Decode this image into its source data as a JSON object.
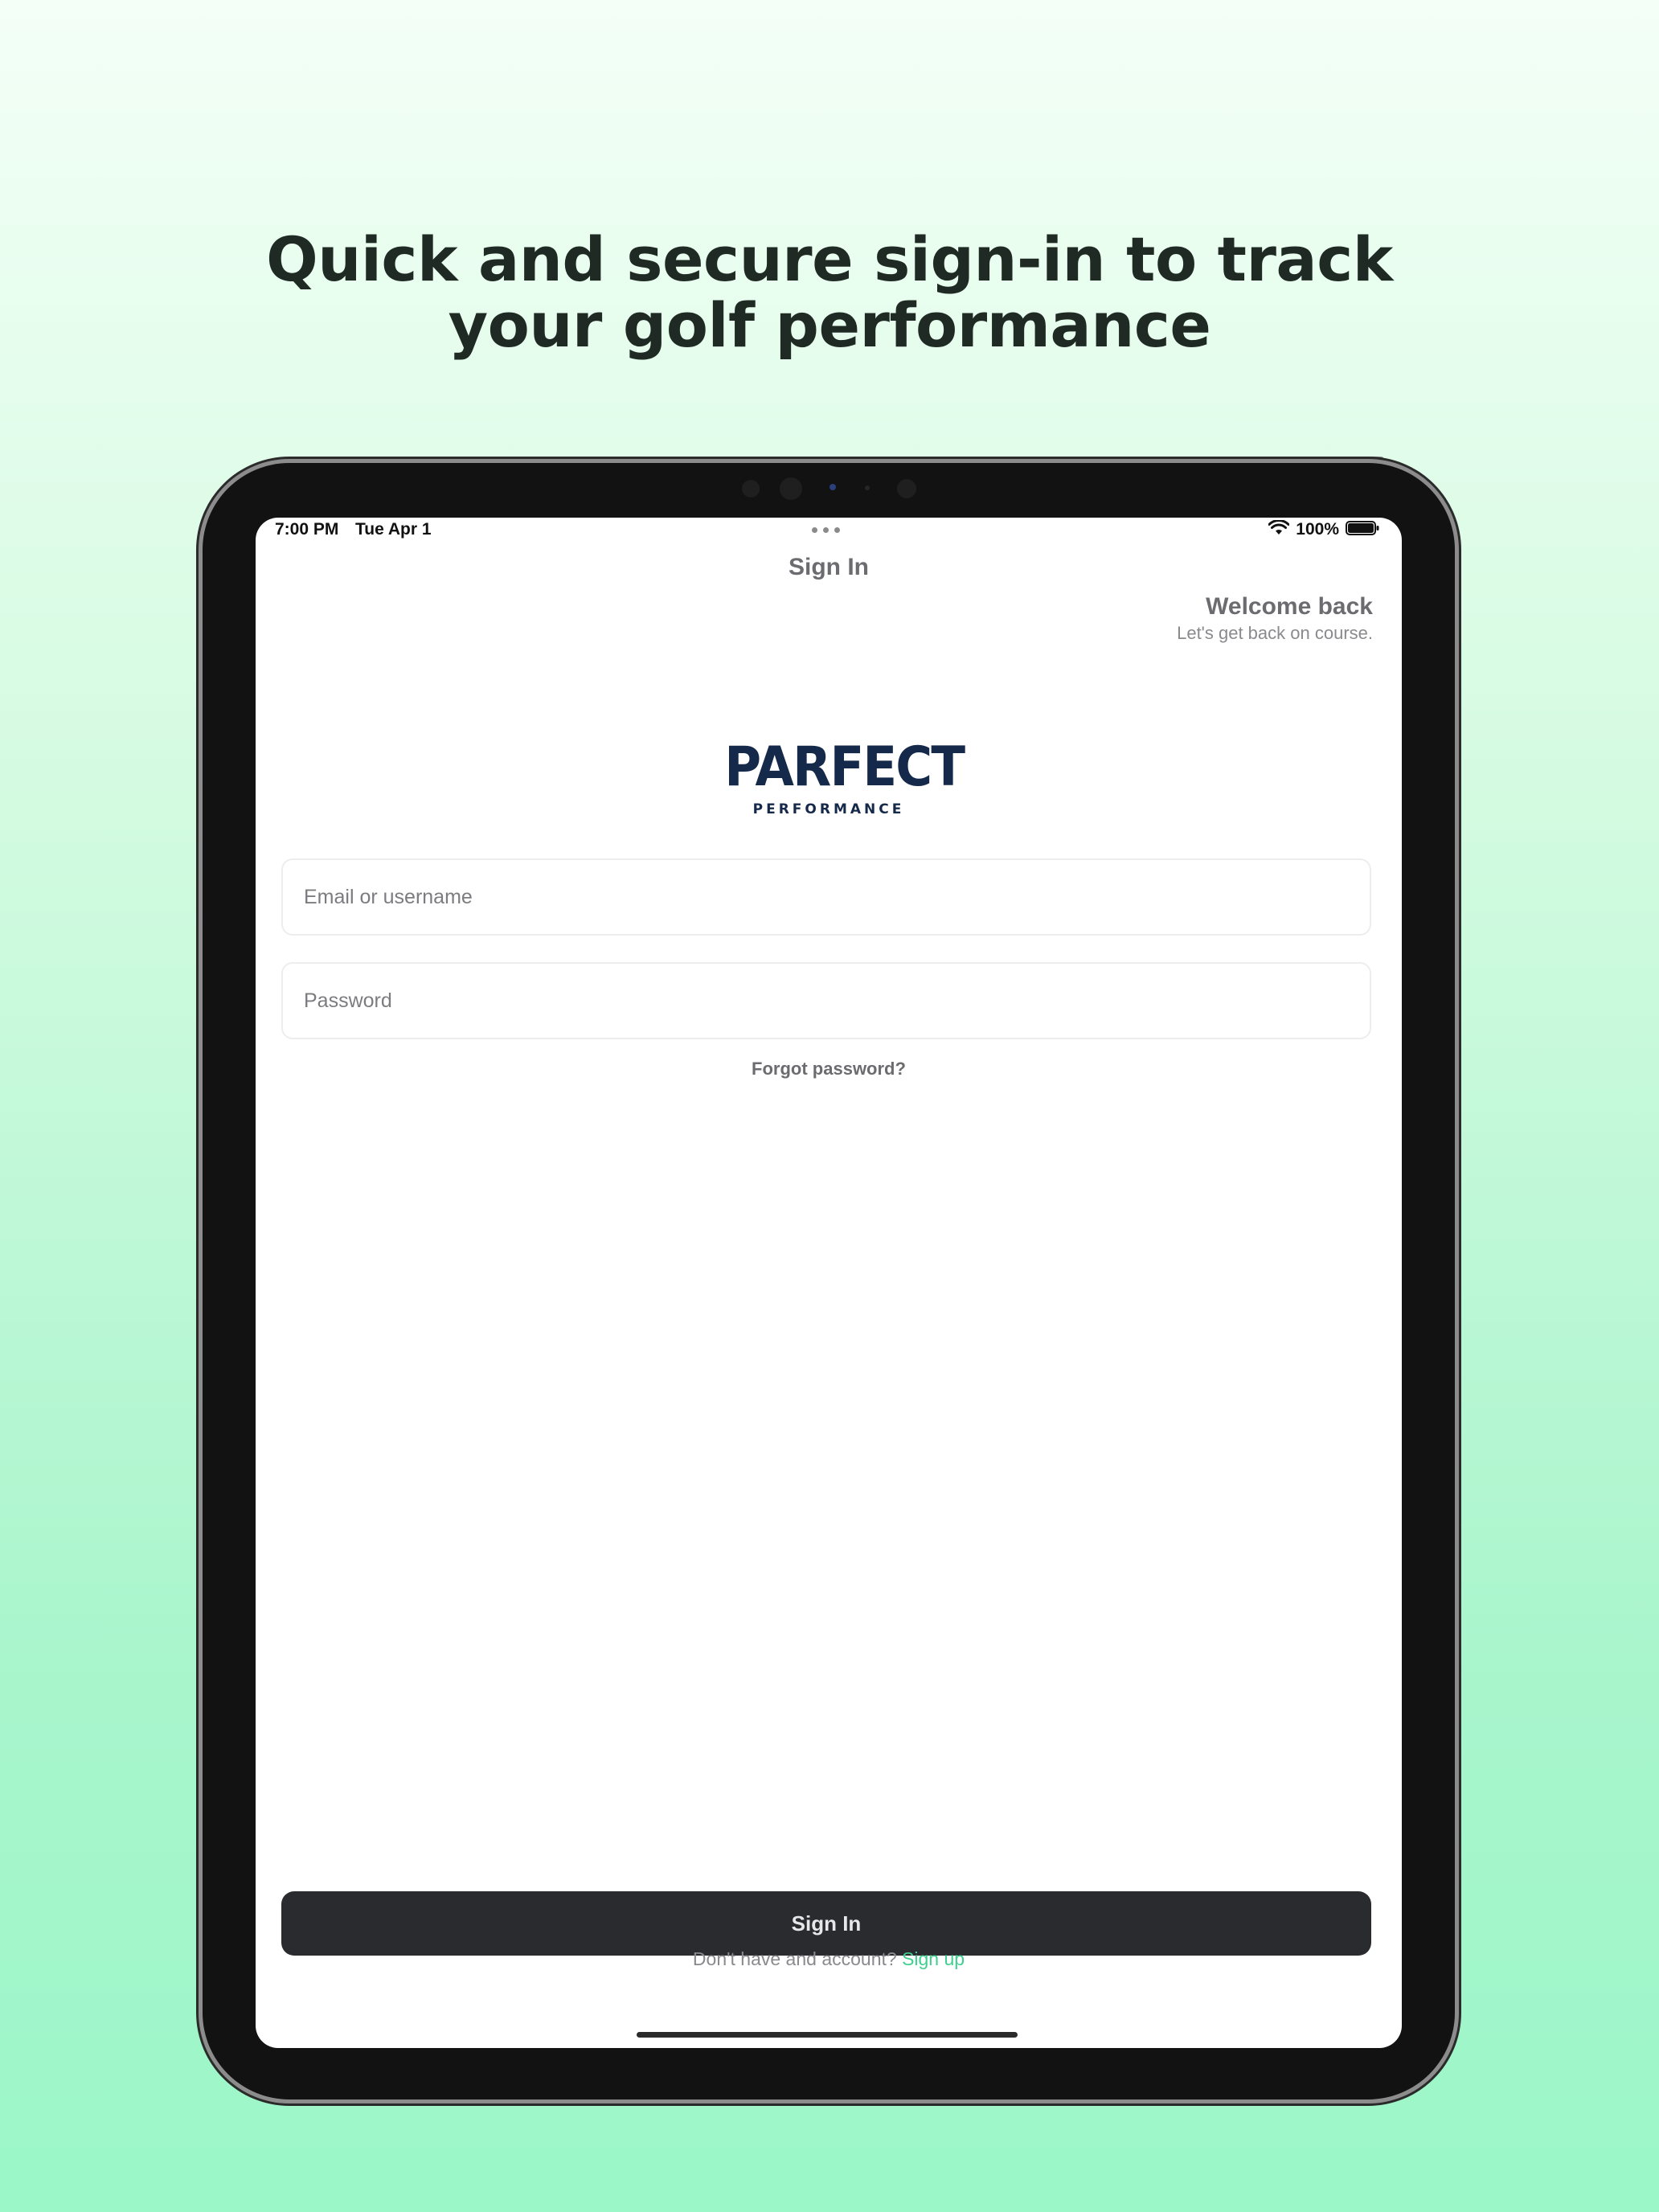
{
  "headline": {
    "line1": "Quick and secure sign-in to track",
    "line2": "your golf performance"
  },
  "status_bar": {
    "time": "7:00 PM",
    "date": "Tue Apr 1",
    "battery": "100%",
    "icons": [
      "wifi-icon",
      "battery-icon"
    ]
  },
  "nav": {
    "title": "Sign In"
  },
  "welcome": {
    "title": "Welcome back",
    "subtitle": "Let's get back on course."
  },
  "logo": {
    "main": "PARFECT",
    "sub": "PERFORMANCE",
    "color": "#15294a"
  },
  "form": {
    "email_placeholder": "Email or username",
    "email_value": "",
    "password_placeholder": "Password",
    "password_value": "",
    "forgot_label": "Forgot password?"
  },
  "actions": {
    "signin_label": "Sign In",
    "signup_prompt": "Don't have and account?",
    "signup_link": "Sign up"
  },
  "colors": {
    "accent": "#3fcf8e",
    "button": "#2a2b2e",
    "background_top": "#f4fff7",
    "background_bottom": "#9bf7c8"
  }
}
